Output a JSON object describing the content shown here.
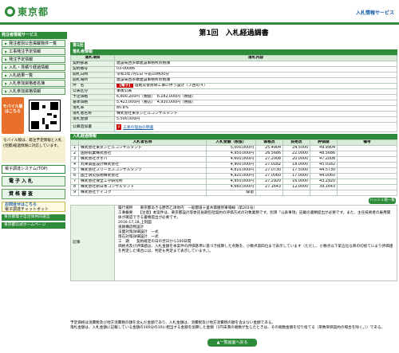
{
  "header": {
    "logo_text": "東京都",
    "service": "入札情報サービス"
  },
  "sidebar": {
    "section_title": "発注者情報サービス",
    "items": [
      "発注者別公告掲載物件一覧",
      "工事発注予定情報",
      "発注予定情報",
      "入札・見積り経過情報",
      "入札結果一覧",
      "入札参加資格者名簿",
      "入札参加資格情報"
    ],
    "mobile_label": "モバイル版はこちら",
    "note": "モバイル版は、発注予定情報と入札(見積)経過情報に対応しています。",
    "ebid": "電子調達システム(TOP)",
    "btn_bid": "電子入札",
    "btn_qual": "資格審査",
    "help_line1": "お問合せはこちら",
    "help_line2": "電子調達チャットボット",
    "links": [
      "東京都電子自治体共同運営",
      "東京都公式ホームページ"
    ]
  },
  "page": {
    "title": "第1回　入札経過調書",
    "panel": "第1回"
  },
  "info": {
    "section": "落札者情報",
    "head_item": "落札項目",
    "head_content": "落札内容",
    "rows": [
      {
        "k": "契約部署",
        "v": "建設局西多摩建設事務所庶務課"
      },
      {
        "k": "契約番号",
        "v": "03-00086"
      },
      {
        "k": "開札日時",
        "v": "令和3年7月1日 午前10時30分"
      },
      {
        "k": "開札場所",
        "v": "建設局西多摩建設事務所庶務課"
      }
    ],
    "name_label": "件　名",
    "name_badge": "【電子】",
    "name_value": "道路災害防除工事に伴う設計（３西の４）",
    "rows2": [
      {
        "k": "公表区分",
        "v": "事後公表"
      },
      {
        "k": "予定価格",
        "v": "6,800,200円（税抜）　6,182,000円（税抜）"
      },
      {
        "k": "基準価格",
        "v": "5,423,000円（税込）　4,930,000円（税抜）"
      },
      {
        "k": "落札率",
        "v": "80.8%"
      },
      {
        "k": "落札者名称",
        "v": "株式会社東京シビルコンサルタント"
      },
      {
        "k": "落札金額",
        "v": "5,500,000円"
      }
    ],
    "notice_label": "公募追加書",
    "notice_link": "工事の理由の明書"
  },
  "bids": {
    "section": "入札経過情報",
    "headers": [
      "",
      "入札者名称",
      "入札金額（税抜）",
      "価格点",
      "技術点",
      "評価値",
      "備考"
    ],
    "rows": [
      {
        "no": "1",
        "name": "株式会社東京シビルコンサルタント",
        "amount": "5,000,000円",
        "price": "25.4904",
        "tech": "24.5000",
        "eval": "49.9904",
        "note": ""
      },
      {
        "no": "2",
        "name": "国際航業株式会社",
        "amount": "4,950,000円",
        "price": "26.5686",
        "tech": "22.0000",
        "eval": "48.5686",
        "note": ""
      },
      {
        "no": "3",
        "name": "株式会社オオバ",
        "amount": "4,600,000円",
        "price": "27.2008",
        "tech": "20.0000",
        "eval": "47.2008",
        "note": ""
      },
      {
        "no": "4",
        "name": "丸栄調査設計株式会社",
        "amount": "4,900,000円",
        "price": "27.0182",
        "tech": "18.0000",
        "eval": "45.0182",
        "note": ""
      },
      {
        "no": "5",
        "name": "株式会社スリーエスコンサルタンツ",
        "amount": "4,810,000円",
        "price": "27.0730",
        "tech": "17.5000",
        "eval": "44.5730",
        "note": ""
      },
      {
        "no": "6",
        "name": "国土防災技術株式会社",
        "amount": "4,920,000円",
        "price": "27.0060",
        "tech": "17.0000",
        "eval": "44.0060",
        "note": ""
      },
      {
        "no": "7",
        "name": "株式会社保全工学研究所",
        "amount": "4,950,000円",
        "price": "27.2920",
        "tech": "16.0000",
        "eval": "43.2920",
        "note": ""
      },
      {
        "no": "8",
        "name": "株式会社新日本コンサルタント",
        "amount": "4,660,000円",
        "price": "27.1643",
        "tech": "12.0000",
        "eval": "39.1643",
        "note": ""
      },
      {
        "no": "9",
        "name": "株式会社テイコク",
        "amount": "辞退",
        "price": "",
        "tech": "",
        "eval": "",
        "note": ""
      }
    ],
    "hs_button": "ハッシュ値一覧"
  },
  "remarks": {
    "label": "記事",
    "text": "履行場所　　東京都あきる野市乙津地内　一般都道十里木御膳停車場線（第201号）\n工事概要　　【注意】本案件は、東京都設計等委託長期包括契約の評価方式の対象業務です。別添「公表事項」記載の書類提出が必要です。また、主任技術者の雇用関係が確認できる書類提出が必要です。\n2016-17,18,上刻図\n道路構造物設計\n法面対策詳細設計　一式\n落石対策詳細設計　一式\n工　期　　契約確定の日の翌日から100日間\n価格点及び評価値は、入札金額を本案件の評価基準に基づき換算した点数を、小数点第四位まで表示しています（ただし、小数点以下第五位以降の切捨てにより評価値を判定した場合には、判定も判定まで表示しています。）。"
  },
  "footer": {
    "text": "予定価格は消費税及び地方消費税の額を含んだ金額であり、入札金額は、消費税及び地方消費税の額を含まない金額である。\n落札金額は、入札金額に記載している金額の100分の10に相当する金額を加算した金額（1円未満の端数が生じたときは、その端数金額を切り捨てる（単数単価契約の場合を除く。））である。",
    "back": "▲一覧画面へ戻る"
  }
}
